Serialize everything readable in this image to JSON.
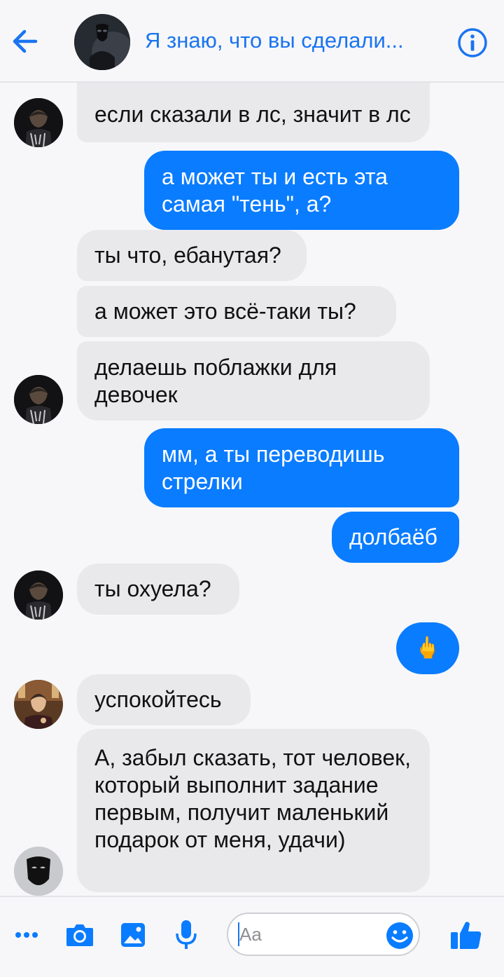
{
  "header": {
    "title": "Я знаю, что вы сделали...",
    "back_icon": "arrow-left-icon",
    "info_icon": "info-icon",
    "accent_color": "#1a74f0"
  },
  "messages": [
    {
      "from": "member1",
      "text": "если сказали в лс, значит в лс"
    },
    {
      "from": "me",
      "text": "а может ты и есть эта самая \"тень\", а?"
    },
    {
      "from": "member1",
      "text": "ты что, ебанутая?"
    },
    {
      "from": "member1",
      "text": "а может это всё-таки ты?"
    },
    {
      "from": "member1",
      "text": "делаешь поблажки для девочек"
    },
    {
      "from": "me",
      "text": "мм, а ты переводишь стрелки"
    },
    {
      "from": "me",
      "text": "долбаёб"
    },
    {
      "from": "member1",
      "text": "ты охуела?"
    },
    {
      "from": "me",
      "text": "🖕",
      "icon": "middle-finger-emoji"
    },
    {
      "from": "member2",
      "text": "успокойтесь"
    },
    {
      "from": "host",
      "text": "А, забыл сказать, тот человек, который выполнит задание первым, получит маленький подарок от меня, удачи)"
    }
  ],
  "composer": {
    "placeholder": "Aa",
    "icons": [
      "more-icon",
      "camera-icon",
      "image-icon",
      "microphone-icon",
      "emoji-icon",
      "thumbs-up-icon"
    ]
  },
  "colors": {
    "incoming_bubble": "#e9e9eb",
    "outgoing_bubble": "#0a7cff",
    "background": "#f7f7f9"
  }
}
